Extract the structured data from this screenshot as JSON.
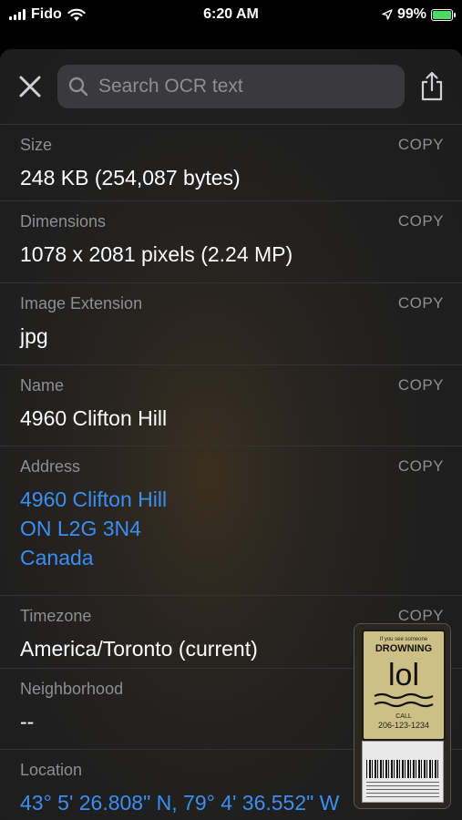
{
  "status": {
    "carrier": "Fido",
    "time": "6:20 AM",
    "battery": "99%",
    "battery_level": 0.99
  },
  "search": {
    "placeholder": "Search OCR text"
  },
  "icons": {
    "close": "close-icon",
    "search": "search-icon",
    "share": "share-icon"
  },
  "rows": [
    {
      "label": "Size",
      "copy": "COPY",
      "value": "248 KB (254,087 bytes)"
    },
    {
      "label": "Dimensions",
      "copy": "COPY",
      "value": "1078 x 2081 pixels (2.24 MP)"
    },
    {
      "label": "Image Extension",
      "copy": "COPY",
      "value": "jpg"
    },
    {
      "label": "Name",
      "copy": "COPY",
      "value": "4960 Clifton Hill"
    },
    {
      "label": "Address",
      "copy": "COPY",
      "value_lines": [
        "4960 Clifton Hill",
        "ON L2G 3N4",
        "Canada"
      ]
    },
    {
      "label": "Timezone",
      "copy": "COPY",
      "value": "America/Toronto (current)"
    },
    {
      "label": "Neighborhood",
      "value": "--"
    },
    {
      "label": "Location",
      "value": "43° 5' 26.808\" N, 79° 4' 36.552\" W"
    }
  ],
  "thumbnail": {
    "line1": "If you see someone",
    "line2": "DROWNING",
    "line3": "lol",
    "line4": "CALL",
    "line5": "206-123-1234"
  },
  "colors": {
    "link": "#3a8ff2",
    "muted": "#8e8e93",
    "battery": "#4cd964"
  }
}
